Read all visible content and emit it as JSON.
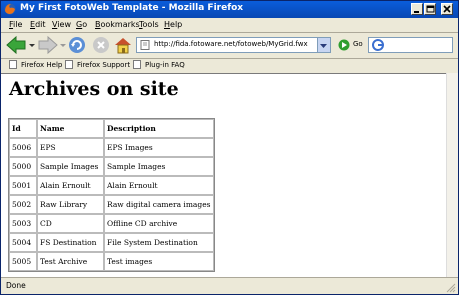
{
  "window": {
    "title": "My First FotoWeb Template - Mozilla Firefox"
  },
  "menu": [
    {
      "accel": "F",
      "rest": "ile"
    },
    {
      "accel": "E",
      "rest": "dit"
    },
    {
      "accel": "V",
      "rest": "iew"
    },
    {
      "accel": "G",
      "rest": "o"
    },
    {
      "accel": "B",
      "rest": "ookmarks"
    },
    {
      "accel": "T",
      "rest": "ools"
    },
    {
      "accel": "H",
      "rest": "elp"
    }
  ],
  "navigation": {
    "url": "http://fida.fotoware.net/fotoweb/MyGrid.fwx",
    "go_label": "Go",
    "search_value": ""
  },
  "bookmarks": [
    "Firefox Help",
    "Firefox Support",
    "Plug-in FAQ"
  ],
  "page": {
    "heading": "Archives on site",
    "table": {
      "headers": [
        "Id",
        "Name",
        "Description"
      ],
      "rows": [
        [
          "5006",
          "EPS",
          "EPS Images"
        ],
        [
          "5000",
          "Sample Images",
          "Sample Images"
        ],
        [
          "5001",
          "Alain Ernoult",
          "Alain Ernoult"
        ],
        [
          "5002",
          "Raw Library",
          "Raw digital camera images"
        ],
        [
          "5003",
          "CD",
          "Offline CD archive"
        ],
        [
          "5004",
          "FS Destination",
          "File System Destination"
        ],
        [
          "5005",
          "Test Archive",
          "Test images"
        ]
      ]
    }
  },
  "status": {
    "text": "Done"
  },
  "colors": {
    "titlebar": "#0a5ddb",
    "chrome": "#ece9d8",
    "go_icon": "#2f9e2f",
    "back_arrow": "#3aa53a"
  }
}
